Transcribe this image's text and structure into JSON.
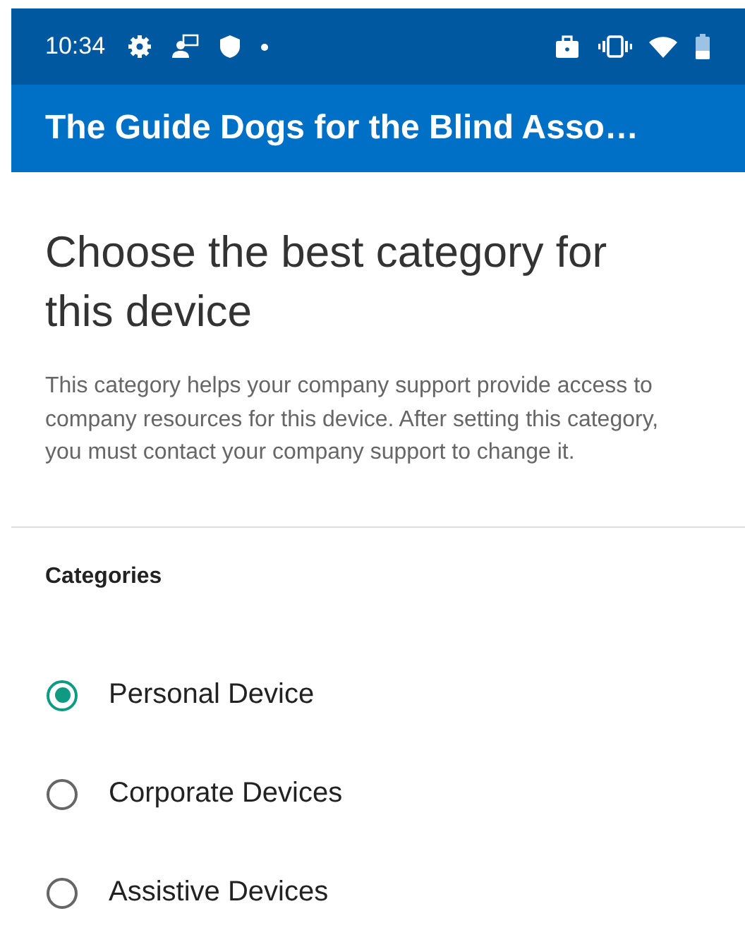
{
  "status_bar": {
    "time": "10:34"
  },
  "app_bar": {
    "title": "The Guide Dogs for the Blind Asso…"
  },
  "heading": "Choose the best category for this device",
  "description": "This category helps your company support provide access to company resources for this device. After setting this category, you must contact your company support to change it.",
  "categories_label": "Categories",
  "categories": [
    {
      "label": "Personal Device",
      "selected": true
    },
    {
      "label": "Corporate Devices",
      "selected": false
    },
    {
      "label": "Assistive Devices",
      "selected": false
    }
  ]
}
